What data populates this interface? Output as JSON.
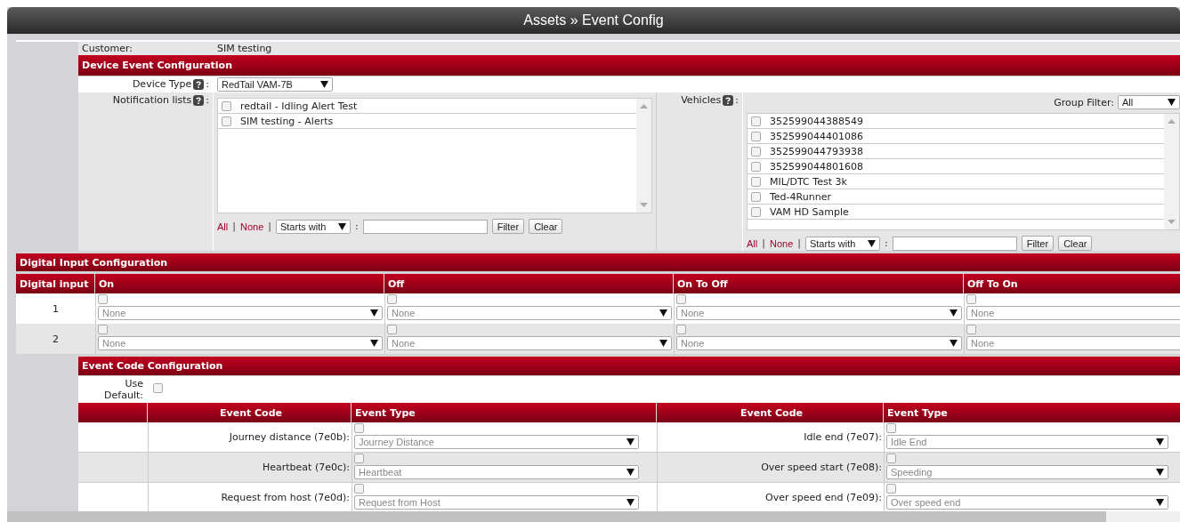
{
  "title": "Assets » Event Config",
  "customer": {
    "label": "Customer:",
    "value": "SIM testing"
  },
  "device_event": {
    "header": "Device Event Configuration",
    "device_type": {
      "label": "Device Type",
      "colon": ":",
      "value": "RedTail VAM-7B"
    },
    "notification_lists": {
      "label": "Notification lists",
      "colon": ":",
      "items": [
        {
          "label": "redtail - Idling Alert Test",
          "checked": false
        },
        {
          "label": "SIM testing - Alerts",
          "checked": false
        }
      ],
      "filter": {
        "all": "All",
        "separators": [
          "|",
          "|"
        ],
        "none": "None",
        "mode": "Starts with",
        "colon": ":",
        "filter_button": "Filter",
        "clear_button": "Clear"
      }
    },
    "vehicles": {
      "label": "Vehicles",
      "colon": ":",
      "group_filter": {
        "label": "Group Filter:",
        "value": "All"
      },
      "items": [
        {
          "label": "352599044388549",
          "checked": false
        },
        {
          "label": "352599044401086",
          "checked": false
        },
        {
          "label": "352599044793938",
          "checked": false
        },
        {
          "label": "352599044801608",
          "checked": false
        },
        {
          "label": "MIL/DTC Test 3k",
          "checked": false
        },
        {
          "label": "Ted-4Runner",
          "checked": false
        },
        {
          "label": "VAM HD Sample",
          "checked": false
        }
      ],
      "filter": {
        "all": "All",
        "separators": [
          "|",
          "|"
        ],
        "none": "None",
        "mode": "Starts with",
        "colon": ":",
        "filter_button": "Filter",
        "clear_button": "Clear"
      }
    }
  },
  "digital_input": {
    "header": "Digital Input Configuration",
    "columns": [
      "Digital input",
      "On",
      "Off",
      "On To Off",
      "Off To On"
    ],
    "rows": [
      {
        "cells": [
          {
            "kind": "number",
            "text": "1"
          },
          {
            "kind": "input",
            "checked": false,
            "value": "None"
          },
          {
            "kind": "input",
            "checked": false,
            "value": "None"
          },
          {
            "kind": "input",
            "checked": false,
            "value": "None"
          },
          {
            "kind": "input",
            "checked": false,
            "value": "None"
          }
        ]
      },
      {
        "cells": [
          {
            "kind": "number",
            "text": "2"
          },
          {
            "kind": "input",
            "checked": false,
            "value": "None"
          },
          {
            "kind": "input",
            "checked": false,
            "value": "None"
          },
          {
            "kind": "input",
            "checked": false,
            "value": "None"
          },
          {
            "kind": "input",
            "checked": false,
            "value": "None"
          }
        ]
      }
    ]
  },
  "event_code": {
    "header": "Event Code Configuration",
    "use_default": {
      "label": "Use Default:",
      "checked": false
    },
    "columns": [
      "Event Code",
      "Event Type",
      "Event Code",
      "Event Type"
    ],
    "rows": [
      {
        "pairs": [
          {
            "code": "Journey distance (7e0b):",
            "checked": false,
            "type": "Journey Distance"
          },
          {
            "code": "Idle end (7e07):",
            "checked": false,
            "type": "Idle End"
          }
        ]
      },
      {
        "pairs": [
          {
            "code": "Heartbeat (7e0c):",
            "checked": false,
            "type": "Heartbeat"
          },
          {
            "code": "Over speed start (7e08):",
            "checked": false,
            "type": "Speeding"
          }
        ]
      },
      {
        "pairs": [
          {
            "code": "Request from host (7e0d):",
            "checked": false,
            "type": "Request from Host"
          },
          {
            "code": "Over speed end (7e09):",
            "checked": false,
            "type": "Over speed end"
          }
        ]
      }
    ]
  }
}
